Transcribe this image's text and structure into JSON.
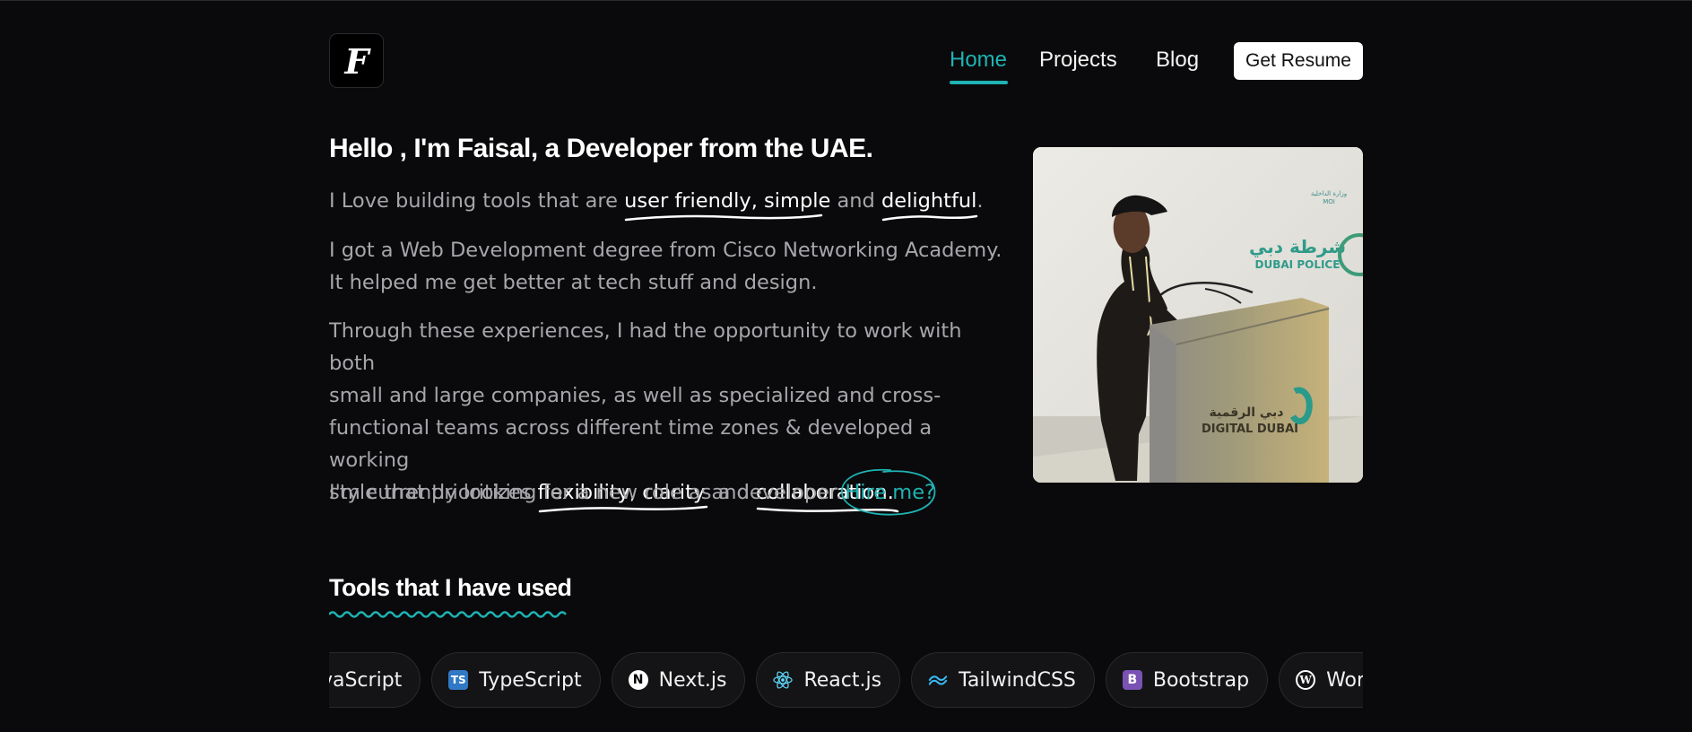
{
  "logo": {
    "letter": "F"
  },
  "nav": {
    "items": [
      {
        "label": "Home",
        "active": true
      },
      {
        "label": "Projects",
        "active": false
      },
      {
        "label": "Blog",
        "active": false
      }
    ],
    "resume_label": "Get Resume"
  },
  "hero": {
    "heading": "Hello , I'm Faisal, a Developer from the UAE.",
    "p1": {
      "pre": "I Love building tools that are ",
      "hl1": "user friendly, simple",
      "mid": " and ",
      "hl2": "delightful",
      "post": "."
    },
    "p2": "I got a Web Development degree from Cisco Networking Academy. It helped me get better at tech stuff and design.",
    "p3": {
      "lines": [
        "Through these experiences, I had the opportunity to work with both",
        "small and large companies, as well as specialized and cross-",
        "functional teams across different time zones & developed a working"
      ],
      "pre": "style that prioritizes ",
      "hl1": "flexibility, clarity",
      "mid": " and ",
      "hl2": "collaboration."
    },
    "p4": {
      "text": "I'm currently looking for a new role as a developer.",
      "hire": "Hire me?"
    }
  },
  "photo": {
    "sign_ar": "شرطة دبي",
    "sign_en": "DUBAI POLICE",
    "podium_ar": "دبي الرقمية",
    "podium_en": "DIGITAL DUBAI"
  },
  "tools": {
    "title": "Tools that I have used",
    "items": [
      {
        "label": "JavaScript",
        "icon": "javascript-icon",
        "color": "#f7df1e"
      },
      {
        "label": "TypeScript",
        "icon": "typescript-icon",
        "color": "#3178c6"
      },
      {
        "label": "Next.js",
        "icon": "nextjs-icon",
        "color": "#ffffff"
      },
      {
        "label": "React.js",
        "icon": "react-icon",
        "color": "#61dafb"
      },
      {
        "label": "TailwindCSS",
        "icon": "tailwind-icon",
        "color": "#38bdf8"
      },
      {
        "label": "Bootstrap",
        "icon": "bootstrap-icon",
        "color": "#7952b3"
      },
      {
        "label": "WordPress",
        "icon": "wordpress-icon",
        "color": "#ffffff"
      }
    ]
  },
  "colors": {
    "accent": "#1fb3b3",
    "background": "#0a0a0c"
  }
}
